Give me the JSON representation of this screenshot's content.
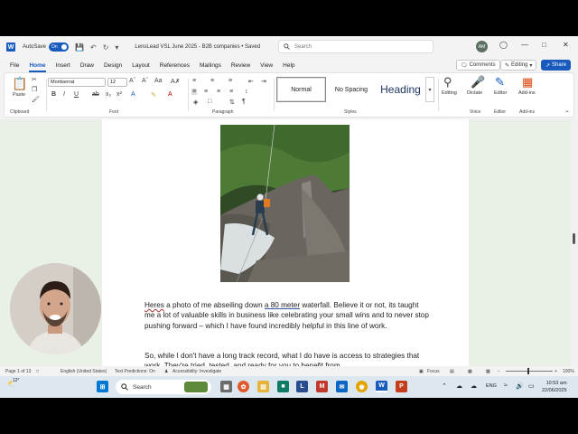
{
  "titlebar": {
    "app_letter": "W",
    "autosave_label": "AutoSave",
    "autosave_state": "On",
    "doc_title": "LensLead VSL June 2025 - B2B companies • Saved",
    "search_placeholder": "Search",
    "avatar_initials": "AM"
  },
  "menubar": {
    "items": [
      "File",
      "Home",
      "Insert",
      "Draw",
      "Design",
      "Layout",
      "References",
      "Mailings",
      "Review",
      "View",
      "Help"
    ],
    "comments_label": "Comments",
    "editing_label": "Editing",
    "share_label": "Share"
  },
  "ribbon": {
    "paste_label": "Paste",
    "clipboard_label": "Clipboard",
    "font_name": "Montserrat",
    "font_size": "12",
    "font_label": "Font",
    "paragraph_label": "Paragraph",
    "styles": [
      "Normal",
      "No Spacing",
      "Heading"
    ],
    "styles_label": "Styles",
    "editing_label": "Editing",
    "dictate_label": "Dictate",
    "voice_label": "Voice",
    "editor_label": "Editor",
    "editor_group_label": "Editor",
    "addins_label": "Add-ins",
    "addin_group_label": "Add-ins"
  },
  "document": {
    "para1_a": "Heres",
    "para1_b": " a photo of me abseiling down ",
    "para1_c": "a 80 meter",
    "para1_d": " waterfall. Believe it or not, its taught me a lot of valuable skills in business like celebrating your small wins and to never stop pushing forward – which I have found incredibly helpful in this line of work.",
    "para2": "So, while I don't have a long track record, what I do have is access to strategies that work. They're tried, tested, and ready for you to benefit from."
  },
  "statusbar": {
    "page": "Page 1 of 13",
    "language": "English (United States)",
    "predictions": "Text Predictions: On",
    "accessibility": "Accessibility: Investigate",
    "focus": "Focus",
    "zoom": "100%"
  },
  "taskbar": {
    "weather_temp": "12°",
    "search_label": "Search",
    "lang": "ENG",
    "time": "10:53 am",
    "date": "22/06/2025"
  },
  "colors": {
    "word_blue": "#185abd",
    "doc_background": "#e9f0e6"
  }
}
